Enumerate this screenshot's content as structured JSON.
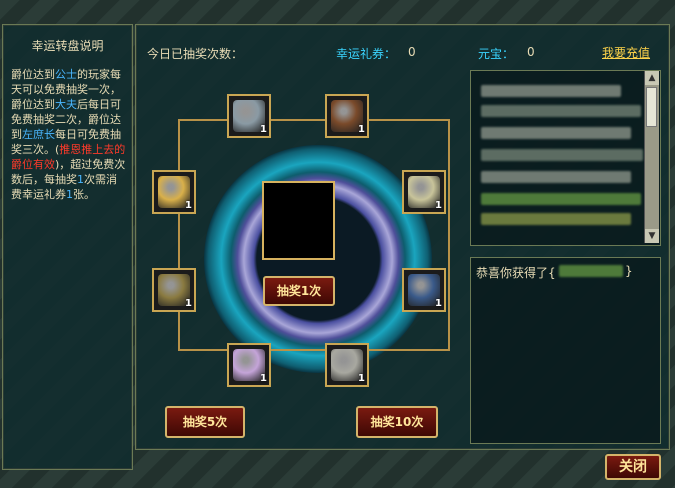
{
  "left": {
    "title": "幸运转盘说明",
    "rules": [
      {
        "text": "爵位达到",
        "c": ""
      },
      {
        "text": "公士",
        "c": "hl-blue"
      },
      {
        "text": "的玩家每天可以免费抽奖一次，爵位达到",
        "c": ""
      },
      {
        "text": "大夫",
        "c": "hl-blue"
      },
      {
        "text": "后每日可免费抽奖二次，爵位达到",
        "c": ""
      },
      {
        "text": "左庶长",
        "c": "hl-blue"
      },
      {
        "text": "每日可免费抽奖三次。(",
        "c": ""
      },
      {
        "text": "推恩推上去的爵位有效",
        "c": "hl-red"
      },
      {
        "text": ")，超过免费次数后，每抽奖",
        "c": ""
      },
      {
        "text": "1",
        "c": "hl-blue"
      },
      {
        "text": "次需消费幸运礼券",
        "c": ""
      },
      {
        "text": "1",
        "c": "hl-blue"
      },
      {
        "text": "张。",
        "c": ""
      }
    ]
  },
  "top": {
    "draws_label": "今日已抽奖次数：",
    "coupon_label": "幸运礼券：",
    "coupon_value": "0",
    "yuanbao_label": "元宝：",
    "yuanbao_value": "0",
    "recharge_link": "我要充值"
  },
  "slots": [
    {
      "name": "armor",
      "count": "1",
      "color": "#8a9aa4"
    },
    {
      "name": "ring",
      "count": "1",
      "color": "#7a4a2a"
    },
    {
      "name": "scroll",
      "count": "1",
      "color": "#d9b04a"
    },
    {
      "name": "coin-pouch",
      "count": "1",
      "color": "#c8c49a"
    },
    {
      "name": "map",
      "count": "1",
      "color": "#8a7a40"
    },
    {
      "name": "helmet",
      "count": "1",
      "color": "#3a5a8a"
    },
    {
      "name": "scroll-purple",
      "count": "1",
      "color": "#c4a4d8"
    },
    {
      "name": "hammer",
      "count": "1",
      "color": "#a8a8a0"
    }
  ],
  "buttons": {
    "draw1": "抽奖1次",
    "draw5": "抽奖5次",
    "draw10": "抽奖10次",
    "close": "关闭"
  },
  "congrats": {
    "text": "恭喜你获得了{",
    "suffix": "}"
  },
  "colors": {
    "accent_gold": "#d4b46a",
    "button_red": "#6a140c",
    "highlight_blue": "#4ab7ff",
    "highlight_red": "#ff3a2a"
  }
}
